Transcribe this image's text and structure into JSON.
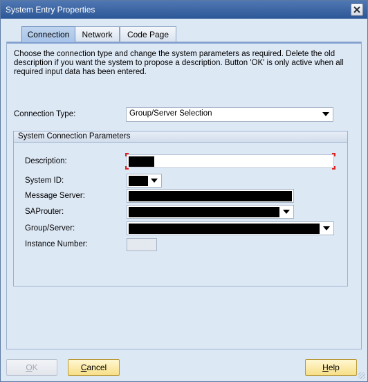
{
  "window": {
    "title": "System Entry Properties"
  },
  "tabs": [
    {
      "label": "Connection",
      "active": true
    },
    {
      "label": "Network",
      "active": false
    },
    {
      "label": "Code Page",
      "active": false
    }
  ],
  "intro_text": "Choose the connection type and change the system parameters as required. Delete the old description if you want the system to propose a description. Button 'OK' is only active when all required input data has been entered.",
  "connection_type": {
    "label": "Connection Type:",
    "value": "Group/Server Selection"
  },
  "params_group": {
    "title": "System Connection Parameters",
    "description_label": "Description:",
    "system_id_label": "System ID:",
    "message_server_label": "Message Server:",
    "saprouter_label": "SAProuter:",
    "group_server_label": "Group/Server:",
    "instance_number_label": "Instance Number:"
  },
  "buttons": {
    "ok": {
      "prefix": "",
      "underline": "O",
      "suffix": "K",
      "enabled": false
    },
    "cancel": {
      "prefix": "",
      "underline": "C",
      "suffix": "ancel"
    },
    "help": {
      "prefix": "",
      "underline": "H",
      "suffix": "elp"
    }
  },
  "colors": {
    "titlebar": "#2c5796",
    "background": "#dde8f5",
    "button_face": "#f7df87",
    "required_marker": "#dd2222"
  }
}
